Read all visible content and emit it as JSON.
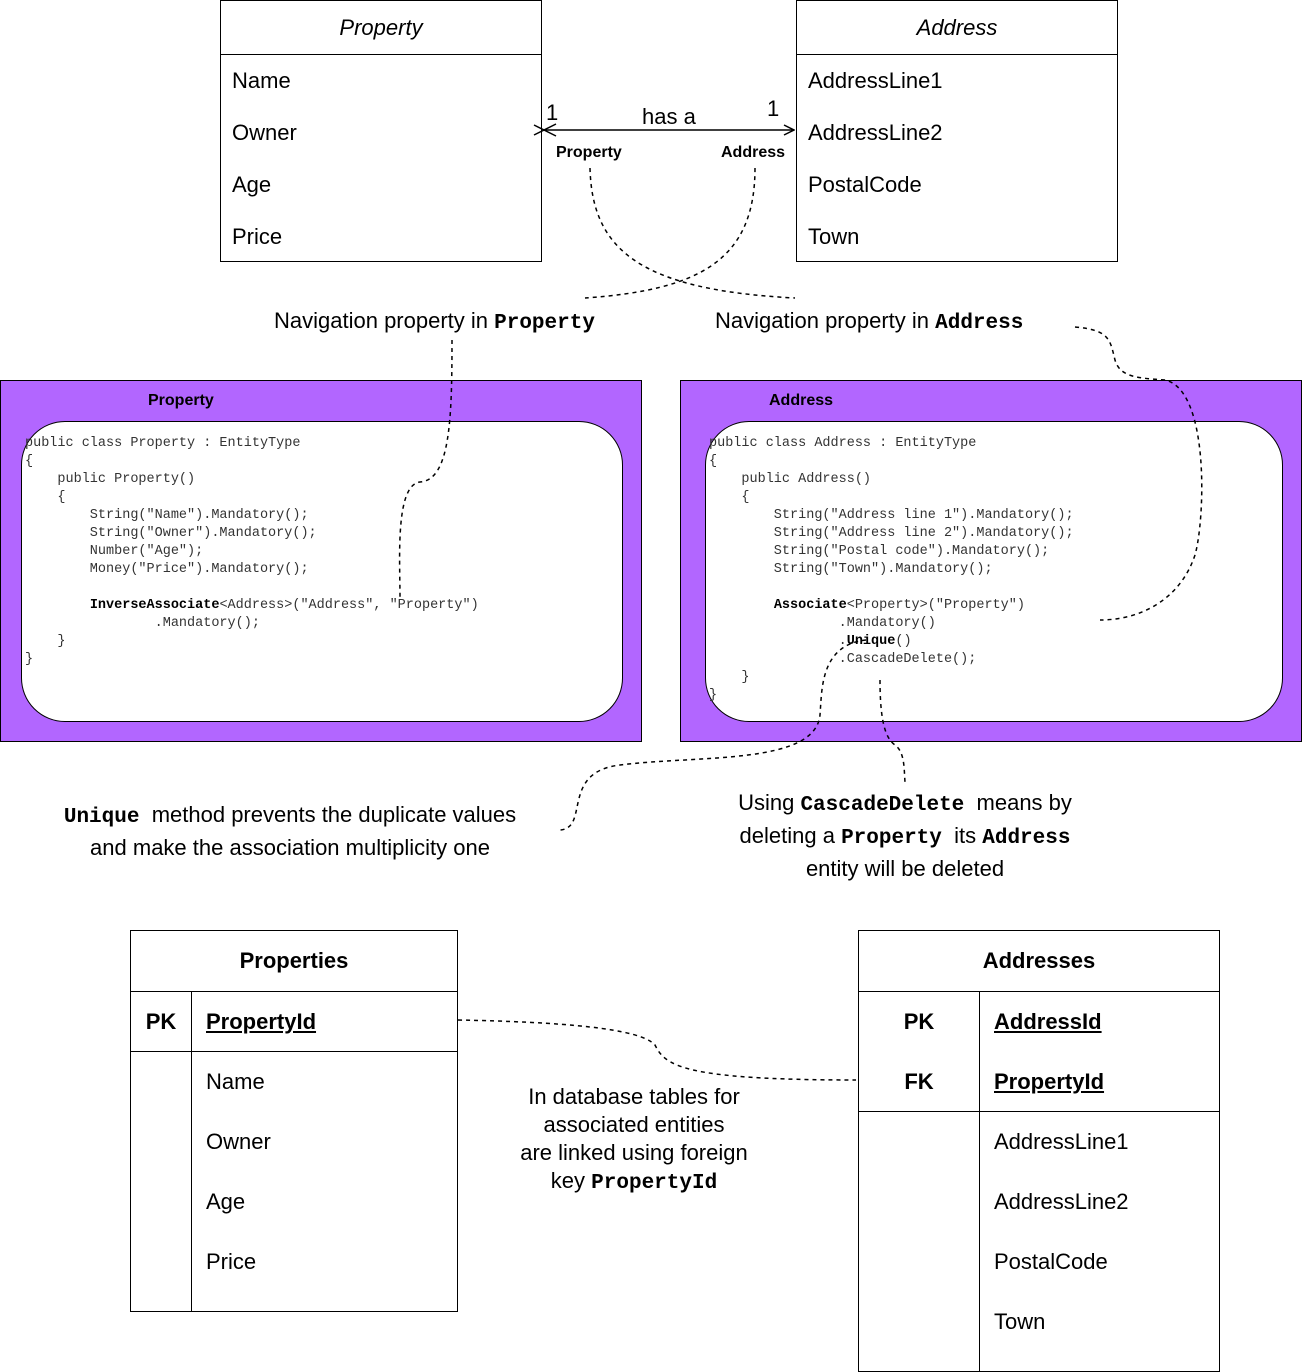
{
  "uml": {
    "property": {
      "title": "Property",
      "attributes": [
        "Name",
        "Owner",
        "Age",
        "Price"
      ]
    },
    "address": {
      "title": "Address",
      "attributes": [
        "AddressLine1",
        "AddressLine2",
        "PostalCode",
        "Town"
      ]
    },
    "association": {
      "label": "has a",
      "left_multiplicity": "1",
      "right_multiplicity": "1",
      "left_role": "Property",
      "right_role": "Address"
    }
  },
  "notes": {
    "nav_property": {
      "text": "Navigation property in ",
      "code": "Property"
    },
    "nav_address": {
      "text": "Navigation property in ",
      "code": "Address"
    },
    "unique": {
      "code": "Unique",
      "line1": "method prevents the duplicate values",
      "line2": "and make the association multiplicity one"
    },
    "cascade": {
      "line1_pre": "Using ",
      "line1_code": "CascadeDelete",
      "line1_post": "means by",
      "line2_pre": "deleting a ",
      "line2_code1": "Property",
      "line2_mid": "its ",
      "line2_code2": "Address",
      "line3": "entity will be deleted"
    },
    "foreign_key": {
      "line1": "In database tables for",
      "line2": "associated entities",
      "line3": "are linked using foreign",
      "line4_pre": "key ",
      "line4_code": "PropertyId"
    }
  },
  "code_panels": {
    "property": {
      "title": "Property",
      "lines": [
        "public class Property : EntityType",
        "{",
        "    public Property()",
        "    {",
        "        String(\"Name\").Mandatory();",
        "        String(\"Owner\").Mandatory();",
        "        Number(\"Age\");",
        "        Money(\"Price\").Mandatory();",
        "",
        "        InverseAssociate<Address>(\"Address\", \"Property\")",
        "                .Mandatory();",
        "    }",
        "}"
      ]
    },
    "address": {
      "title": "Address",
      "lines": [
        "public class Address : EntityType",
        "{",
        "    public Address()",
        "    {",
        "        String(\"Address line 1\").Mandatory();",
        "        String(\"Address line 2\").Mandatory();",
        "        String(\"Postal code\").Mandatory();",
        "        String(\"Town\").Mandatory();",
        "",
        "        Associate<Property>(\"Property\")",
        "                .Mandatory()",
        "                .Unique()",
        "                .CascadeDelete();",
        "    }",
        "}"
      ]
    }
  },
  "tables": {
    "properties": {
      "title": "Properties",
      "pk_label": "PK",
      "pk_name": "PropertyId",
      "columns": [
        "Name",
        "Owner",
        "Age",
        "Price"
      ]
    },
    "addresses": {
      "title": "Addresses",
      "pk_label": "PK",
      "pk_name": "AddressId",
      "fk_label": "FK",
      "fk_name": "PropertyId",
      "columns": [
        "AddressLine1",
        "AddressLine2",
        "PostalCode",
        "Town"
      ]
    }
  }
}
